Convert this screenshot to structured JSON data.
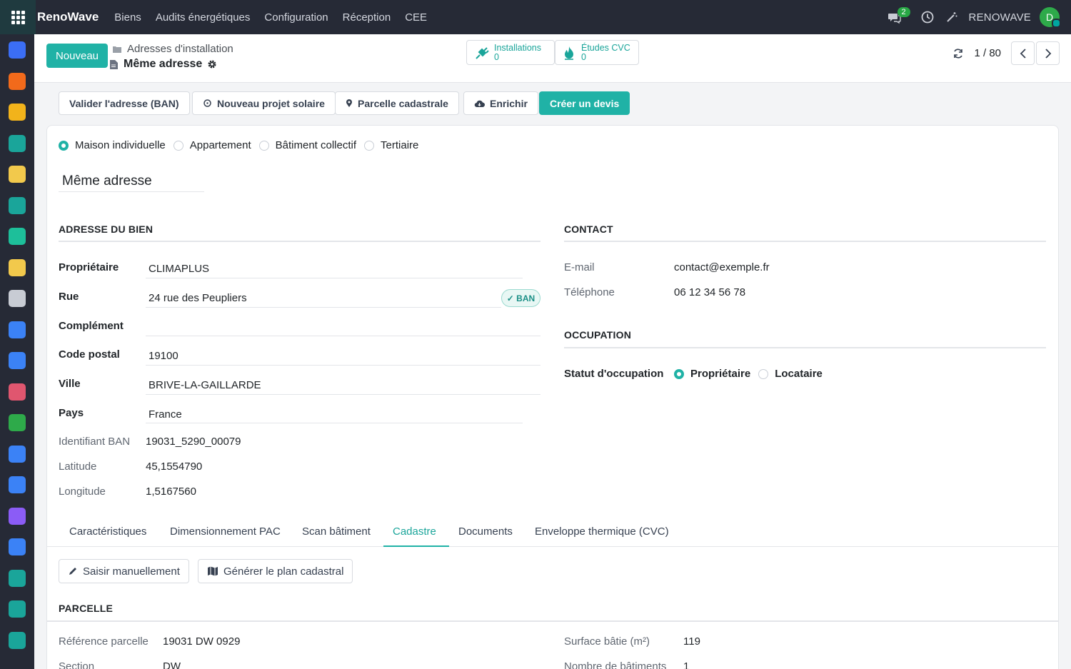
{
  "app": {
    "brand": "RenoWave",
    "menu": [
      "Biens",
      "Audits énergétiques",
      "Configuration",
      "Réception",
      "CEE"
    ],
    "chat_count": "2",
    "company": "RENOWAVE",
    "avatar_initial": "D"
  },
  "rail_icons": [
    {
      "name": "discuss-app-icon",
      "color": "#3b6ef5"
    },
    {
      "name": "chat-app-icon",
      "color": "#f26a1b"
    },
    {
      "name": "calendar-31-app-icon",
      "color": "#f2b31b"
    },
    {
      "name": "sign-app-icon",
      "color": "#1aa59a"
    },
    {
      "name": "crm-app-icon",
      "color": "#f2c94c"
    },
    {
      "name": "contacts-app-icon",
      "color": "#1aa59a"
    },
    {
      "name": "sales-app-icon",
      "color": "#1dbf9a"
    },
    {
      "name": "pos-app-icon",
      "color": "#f2c94c"
    },
    {
      "name": "accounting-app-icon",
      "color": "#c8ccd4"
    },
    {
      "name": "project-app-icon",
      "color": "#3b82f6"
    },
    {
      "name": "planning-app-icon",
      "color": "#3b82f6"
    },
    {
      "name": "dashboard-app-icon",
      "color": "#e0566f"
    },
    {
      "name": "inventory-app-icon",
      "color": "#2eaa4a"
    },
    {
      "name": "calendar-app-icon",
      "color": "#3b82f6"
    },
    {
      "name": "documents-app-icon",
      "color": "#3b82f6"
    },
    {
      "name": "employees-app-icon",
      "color": "#8b5cf6"
    },
    {
      "name": "helpdesk-app-icon",
      "color": "#3b82f6"
    },
    {
      "name": "team-app-icon",
      "color": "#1aa59a"
    },
    {
      "name": "spreadsheet-app-icon",
      "color": "#1aa59a"
    },
    {
      "name": "studio-app-icon",
      "color": "#1aa59a"
    }
  ],
  "control": {
    "new_button": "Nouveau",
    "breadcrumb_parent": "Adresses d'installation",
    "breadcrumb_current": "Même adresse",
    "smart_buttons": [
      {
        "label": "Installations",
        "count": "0"
      },
      {
        "label": "Études CVC",
        "count": "0"
      }
    ],
    "pager": "1 / 80"
  },
  "actions": [
    "Valider l'adresse (BAN)",
    "Nouveau projet solaire",
    "Parcelle cadastrale",
    "Enrichir",
    "Créer un devis"
  ],
  "building_types": [
    "Maison individuelle",
    "Appartement",
    "Bâtiment collectif",
    "Tertiaire"
  ],
  "building_type_selected": "Maison individuelle",
  "record_name": "Même adresse",
  "address": {
    "title": "ADRESSE DU BIEN",
    "owner_label": "Propriétaire",
    "owner": "CLIMAPLUS",
    "street_label": "Rue",
    "street": "24 rue des Peupliers",
    "ban_badge": "✓ BAN",
    "complement_label": "Complément",
    "complement": "",
    "zip_label": "Code postal",
    "zip": "19100",
    "city_label": "Ville",
    "city": "BRIVE-LA-GAILLARDE",
    "country_label": "Pays",
    "country": "France",
    "ban_id_label": "Identifiant BAN",
    "ban_id": "19031_5290_00079",
    "lat_label": "Latitude",
    "lat": "45,1554790",
    "lon_label": "Longitude",
    "lon": "1,5167560"
  },
  "contact": {
    "title": "CONTACT",
    "email_label": "E-mail",
    "email": "contact@exemple.fr",
    "phone_label": "Téléphone",
    "phone": "06 12 34 56 78"
  },
  "occupation": {
    "title": "OCCUPATION",
    "status_label": "Statut d'occupation",
    "options": [
      "Propriétaire",
      "Locataire"
    ],
    "selected": "Propriétaire"
  },
  "tabs": [
    "Caractéristiques",
    "Dimensionnement PAC",
    "Scan bâtiment",
    "Cadastre",
    "Documents",
    "Enveloppe thermique (CVC)"
  ],
  "active_tab": "Cadastre",
  "cadastre": {
    "manual_button": "Saisir manuellement",
    "generate_button": "Générer le plan cadastral",
    "section_title": "PARCELLE",
    "ref_label": "Référence parcelle",
    "ref": "19031 DW 0929",
    "section_label": "Section",
    "section": "DW",
    "surface_label": "Surface bâtie (m²)",
    "surface": "119",
    "buildings_label": "Nombre de bâtiments",
    "buildings": "1"
  },
  "colors": {
    "accent": "#20b2a6",
    "navbar": "#262a36"
  }
}
